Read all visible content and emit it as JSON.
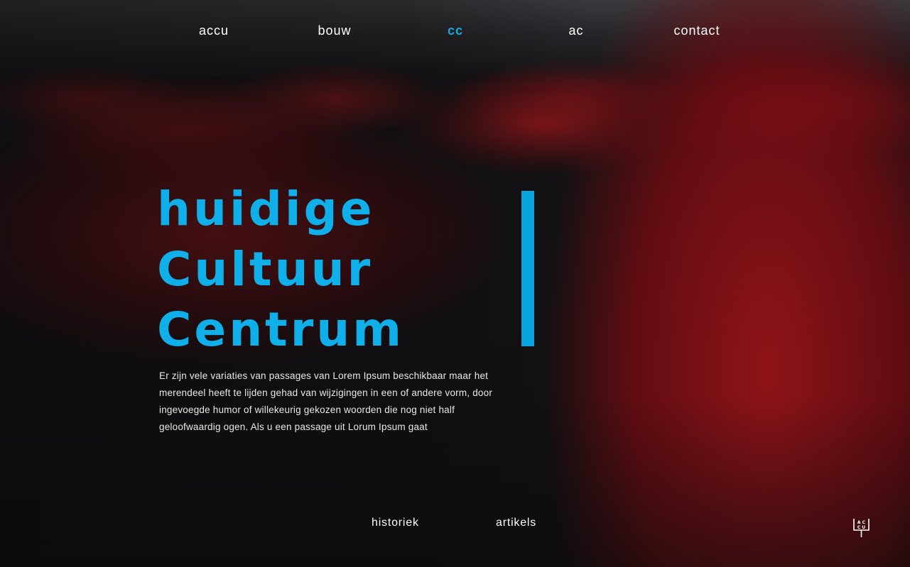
{
  "nav": {
    "items": [
      {
        "label": "accu"
      },
      {
        "label": "bouw"
      },
      {
        "label": "cc"
      },
      {
        "label": "ac"
      },
      {
        "label": "contact"
      }
    ],
    "active_index": 2
  },
  "hero": {
    "title_lines": [
      "huidige",
      "Cultuur",
      "Centrum"
    ],
    "body": "Er zijn vele variaties van passages van Lorem Ipsum beschikbaar maar het merendeel heeft te lijden gehad van wijzigingen in een of andere vorm, door ingevoegde humor of willekeurig gekozen woorden die nog niet half geloofwaardig ogen. Als u een passage uit Lorum Ipsum gaat"
  },
  "sub_nav": {
    "items": [
      {
        "label": "historiek"
      },
      {
        "label": "artikels"
      }
    ]
  },
  "logo": {
    "letters": "AC CU"
  },
  "colors": {
    "accent": "#0fb0ea",
    "seat_red": "#9a1519",
    "background": "#120f10"
  }
}
